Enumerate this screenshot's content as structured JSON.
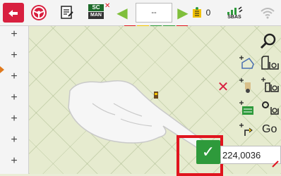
{
  "toolbar": {
    "back_icon": "back-arrow-icon",
    "sc_top": "SC",
    "sc_bottom": "MAN",
    "field_value": "--",
    "count_value": "0",
    "sbas_label": "SBAS"
  },
  "status_bar_colors": [
    "#e0141e",
    "#f2c200",
    "#2e9a3b",
    "#2e9a3b",
    "#e0141e"
  ],
  "left_column": {
    "plus_label": "+",
    "rows": 8
  },
  "right_panel": {
    "go_label_1": "Go",
    "go_label_2": "Go"
  },
  "dialog": {
    "cancel_symbol": "✕",
    "confirm_symbol": "✓",
    "value": "224,0036"
  }
}
